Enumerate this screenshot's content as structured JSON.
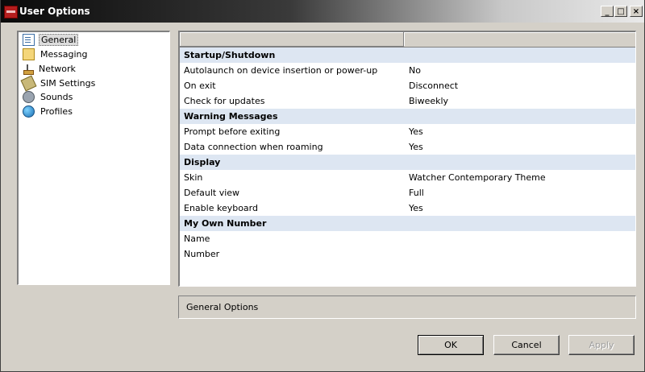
{
  "window": {
    "title": "User Options"
  },
  "sidebar": {
    "items": [
      {
        "label": "General",
        "icon": "general-page-icon",
        "selected": true
      },
      {
        "label": "Messaging",
        "icon": "envelope-icon"
      },
      {
        "label": "Network",
        "icon": "network-icon"
      },
      {
        "label": "SIM Settings",
        "icon": "sim-card-icon"
      },
      {
        "label": "Sounds",
        "icon": "speaker-icon"
      },
      {
        "label": "Profiles",
        "icon": "globe-icon"
      }
    ]
  },
  "grid": {
    "sections": [
      {
        "title": "Startup/Shutdown",
        "rows": [
          {
            "key": "Autolaunch on device insertion or power-up",
            "value": "No"
          },
          {
            "key": "On exit",
            "value": "Disconnect"
          },
          {
            "key": "Check for updates",
            "value": "Biweekly"
          }
        ]
      },
      {
        "title": "Warning Messages",
        "rows": [
          {
            "key": "Prompt before exiting",
            "value": "Yes"
          },
          {
            "key": "Data connection when roaming",
            "value": "Yes"
          }
        ]
      },
      {
        "title": "Display",
        "rows": [
          {
            "key": "Skin",
            "value": "Watcher Contemporary Theme"
          },
          {
            "key": "Default view",
            "value": "Full"
          },
          {
            "key": "Enable keyboard",
            "value": "Yes"
          }
        ]
      },
      {
        "title": "My Own Number",
        "rows": [
          {
            "key": "Name",
            "value": ""
          },
          {
            "key": "Number",
            "value": ""
          }
        ]
      }
    ]
  },
  "description": "General Options",
  "buttons": {
    "ok": "OK",
    "cancel": "Cancel",
    "apply": "Apply"
  },
  "colors": {
    "section_bg": "#dde6f2",
    "window_bg": "#d4d0c8",
    "app_icon": "#b41e1e"
  }
}
